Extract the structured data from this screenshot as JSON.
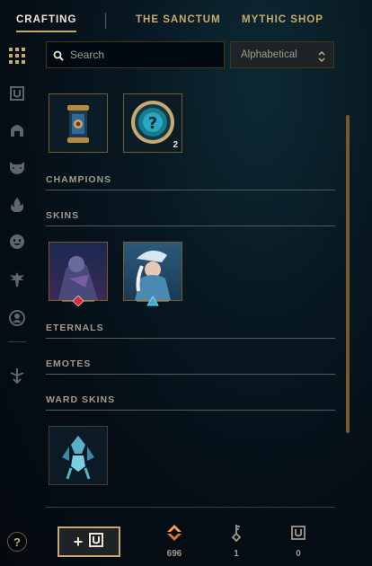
{
  "nav": {
    "tabs": [
      {
        "label": "CRAFTING",
        "active": true
      },
      {
        "label": "THE SANCTUM",
        "active": false
      },
      {
        "label": "MYTHIC SHOP",
        "active": false
      }
    ]
  },
  "sidebar": {
    "items": [
      {
        "icon": "grid-icon",
        "active": true
      },
      {
        "icon": "chest-icon"
      },
      {
        "icon": "helmet-icon"
      },
      {
        "icon": "mask-icon"
      },
      {
        "icon": "flame-icon"
      },
      {
        "icon": "emote-face-icon"
      },
      {
        "icon": "ward-icon"
      },
      {
        "icon": "profile-icon"
      },
      {
        "icon": "sword-down-icon"
      }
    ]
  },
  "search": {
    "placeholder": "Search",
    "value": ""
  },
  "sort": {
    "selected": "Alphabetical"
  },
  "top_items": [
    {
      "name": "capsule-tile",
      "count": ""
    },
    {
      "name": "mystery-orb-tile",
      "count": "2"
    }
  ],
  "sections": {
    "champions": "CHAMPIONS",
    "skins": "SKINS",
    "eternals": "ETERNALS",
    "emotes": "EMOTES",
    "ward_skins": "WARD SKINS"
  },
  "footer": {
    "help_label": "?",
    "add_label": "+",
    "currencies": [
      {
        "icon": "orange-essence-icon",
        "value": "696"
      },
      {
        "icon": "key-icon",
        "value": "1"
      },
      {
        "icon": "chest-icon",
        "value": "0"
      }
    ]
  },
  "colors": {
    "gold": "#c8aa6e",
    "text": "#a09b8c",
    "highlight": "#f0e6d2",
    "orange": "#f0a050",
    "border": "#785a28"
  }
}
